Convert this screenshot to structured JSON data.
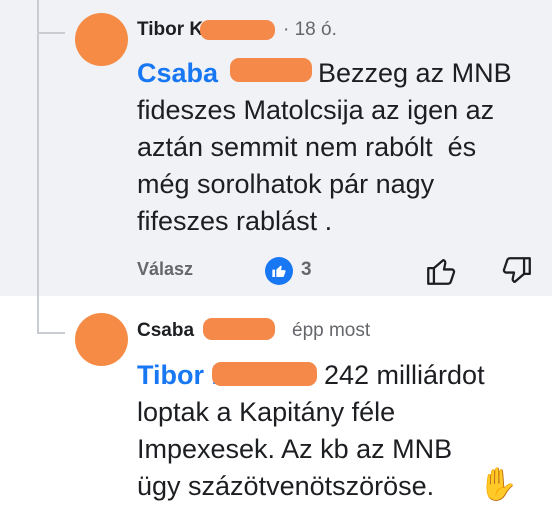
{
  "comments": [
    {
      "author": "Tibor K",
      "time": "· 18 ó.",
      "mention": "Csaba",
      "lines": [
        "Bezzeg az MNB",
        "fideszes Matolcsija az igen az",
        "aztán semmit nem rabólt  és",
        "még sorolhatok pár nagy",
        "fifeszes rablást ."
      ],
      "reply_label": "Válasz",
      "like_count": "3"
    },
    {
      "author": "Csaba",
      "time": "épp most",
      "mention": "Tibor K",
      "lines": [
        "242 milliárdot",
        "loptak a Kapitány féle",
        "Impexesek. Az kb az MNB",
        "ügy százötvenötszöröse."
      ],
      "emoji": "✋"
    }
  ],
  "icons": {
    "like": "thumbs-up-icon",
    "dislike": "thumbs-down-icon",
    "reaction": "like-reaction-icon"
  },
  "colors": {
    "mention": "#1877f2",
    "redaction": "#f58b45",
    "background_first": "#f0f2f5"
  }
}
